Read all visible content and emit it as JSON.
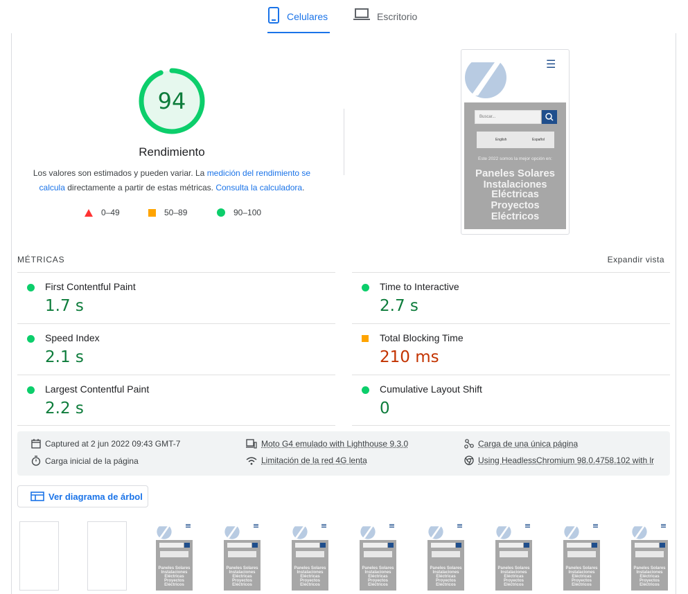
{
  "tabs": [
    {
      "label": "Celulares",
      "active": true,
      "icon": "smartphone-icon"
    },
    {
      "label": "Escritorio",
      "active": false,
      "icon": "laptop-icon"
    }
  ],
  "score": {
    "value": 94,
    "label": "Rendimiento",
    "color": "#0cce6b",
    "desc_prefix": "Los valores son estimados y pueden variar. La ",
    "desc_link1": "medición del rendimiento se calcula",
    "desc_middle": " directamente a partir de estas métricas. ",
    "desc_link2": "Consulta la calculadora",
    "desc_suffix": "."
  },
  "legend": [
    {
      "range": "0–49",
      "shape": "triangle",
      "color": "#ff3333"
    },
    {
      "range": "50–89",
      "shape": "square",
      "color": "#ffa400"
    },
    {
      "range": "90–100",
      "shape": "circle",
      "color": "#0cce6b"
    }
  ],
  "screenshot": {
    "search_placeholder": "Buscar...",
    "lang_en": "English",
    "lang_es": "Español",
    "tagline": "Este 2022 somos la mejor opción en:",
    "lines": [
      "Paneles Solares",
      "Instalaciones",
      "Eléctricas",
      "Proyectos",
      "Eléctricos"
    ]
  },
  "metrics_section": {
    "title": "MÉTRICAS",
    "expand_label": "Expandir vista"
  },
  "metrics": [
    {
      "name": "First Contentful Paint",
      "value": "1.7 s",
      "status": "pass"
    },
    {
      "name": "Time to Interactive",
      "value": "2.7 s",
      "status": "pass"
    },
    {
      "name": "Speed Index",
      "value": "2.1 s",
      "status": "pass"
    },
    {
      "name": "Total Blocking Time",
      "value": "210 ms",
      "status": "average"
    },
    {
      "name": "Largest Contentful Paint",
      "value": "2.2 s",
      "status": "pass"
    },
    {
      "name": "Cumulative Layout Shift",
      "value": "0",
      "status": "pass"
    }
  ],
  "runtime_info": [
    {
      "text": "Captured at 2 jun 2022 09:43 GMT-7",
      "icon": "calendar-icon"
    },
    {
      "text": "Moto G4 emulado with Lighthouse 9.3.0",
      "icon": "devices-icon"
    },
    {
      "text": "Carga de una única página",
      "icon": "nodes-icon"
    },
    {
      "text": "Carga inicial de la página",
      "icon": "timer-icon"
    },
    {
      "text": "Limitación de la red 4G lenta",
      "icon": "wifi-icon"
    },
    {
      "text": "Using HeadlessChromium 98.0.4758.102 with lr",
      "icon": "chrome-icon"
    }
  ],
  "tree_button": {
    "label": "Ver diagrama de árbol",
    "icon": "treemap-icon"
  },
  "filmstrip": {
    "frames": 10,
    "blank_frames": 2,
    "thumb_lines": [
      "Paneles Solares",
      "Instalaciones",
      "Eléctricas",
      "Proyectos",
      "Eléctricos"
    ]
  }
}
